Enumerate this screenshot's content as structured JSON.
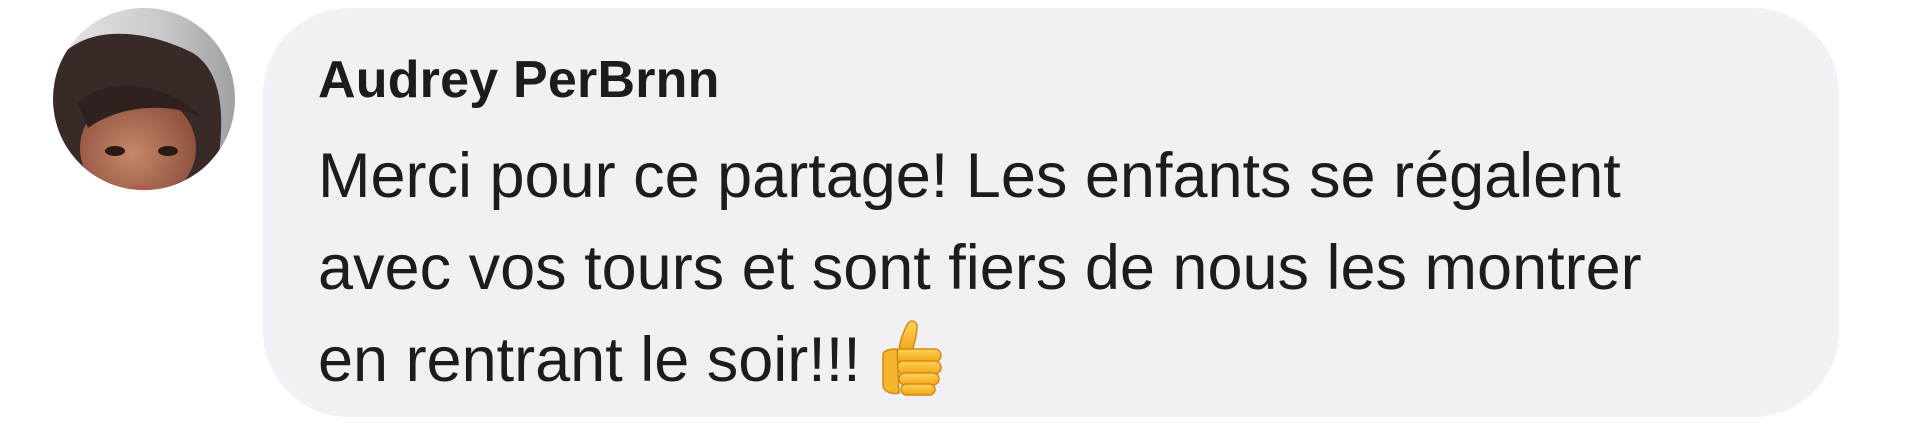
{
  "comment": {
    "author": "Audrey PerBrnn",
    "lines": [
      "Merci pour ce partage! Les enfants se régalent",
      "avec vos tours et sont fiers de nous les montrer",
      "en rentrant le soir!!!"
    ],
    "emoji": "thumbs-up",
    "avatar_icon": "user-avatar-photo",
    "bubble_color": "#f0f0f5",
    "text_color": "#1c1c1e"
  }
}
